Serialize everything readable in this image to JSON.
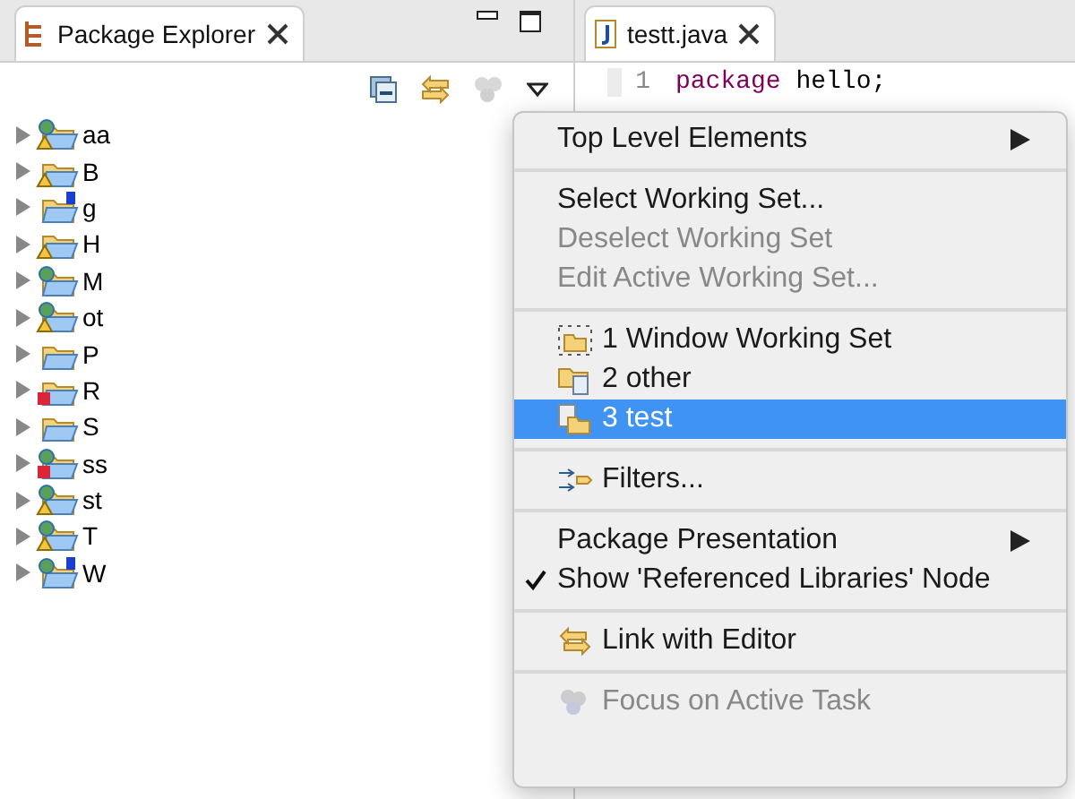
{
  "explorer": {
    "title": "Package Explorer",
    "tree": [
      {
        "label": "aa",
        "kind": "webwarn",
        "expanded": false
      },
      {
        "label": "B",
        "kind": "folderwarn",
        "expanded": false
      },
      {
        "label": "g",
        "kind": "folderspring",
        "expanded": false
      },
      {
        "label": "H",
        "kind": "folderwarn",
        "expanded": false
      },
      {
        "label": "M",
        "kind": "web",
        "expanded": false
      },
      {
        "label": "ot",
        "kind": "webwarn",
        "expanded": false
      },
      {
        "label": "P",
        "kind": "folder",
        "expanded": false
      },
      {
        "label": "R",
        "kind": "foldererror",
        "expanded": false
      },
      {
        "label": "S",
        "kind": "folder",
        "expanded": false
      },
      {
        "label": "ss",
        "kind": "weberror",
        "expanded": false
      },
      {
        "label": "st",
        "kind": "webwarn",
        "expanded": false
      },
      {
        "label": "T",
        "kind": "webwarn",
        "expanded": false
      },
      {
        "label": "W",
        "kind": "webspring",
        "expanded": false
      }
    ]
  },
  "editor": {
    "tab": "testt.java",
    "lines": [
      {
        "number": "1",
        "keyword": "package",
        "rest": "hello;"
      }
    ]
  },
  "menu": [
    {
      "kind": "submenu",
      "label": "Top Level Elements",
      "disabled": false
    },
    {
      "kind": "separator"
    },
    {
      "kind": "text",
      "label": "Select Working Set...",
      "disabled": false
    },
    {
      "kind": "text",
      "label": "Deselect Working Set",
      "disabled": true
    },
    {
      "kind": "text",
      "label": "Edit Active Working Set...",
      "disabled": true
    },
    {
      "kind": "separator"
    },
    {
      "kind": "windowset",
      "label": "1 Window Working Set",
      "selected": false
    },
    {
      "kind": "otherset",
      "label": "2 other",
      "selected": false
    },
    {
      "kind": "testset",
      "label": "3 test",
      "selected": true
    },
    {
      "kind": "separator"
    },
    {
      "kind": "filter",
      "label": "Filters...",
      "disabled": false
    },
    {
      "kind": "separator"
    },
    {
      "kind": "submenu",
      "label": "Package Presentation",
      "disabled": false
    },
    {
      "kind": "check",
      "label": "Show 'Referenced Libraries' Node",
      "checked": true,
      "disabled": false
    },
    {
      "kind": "separator"
    },
    {
      "kind": "link",
      "label": "Link with Editor",
      "disabled": false
    },
    {
      "kind": "separator"
    },
    {
      "kind": "focus",
      "label": "Focus on Active Task",
      "disabled": true
    }
  ]
}
